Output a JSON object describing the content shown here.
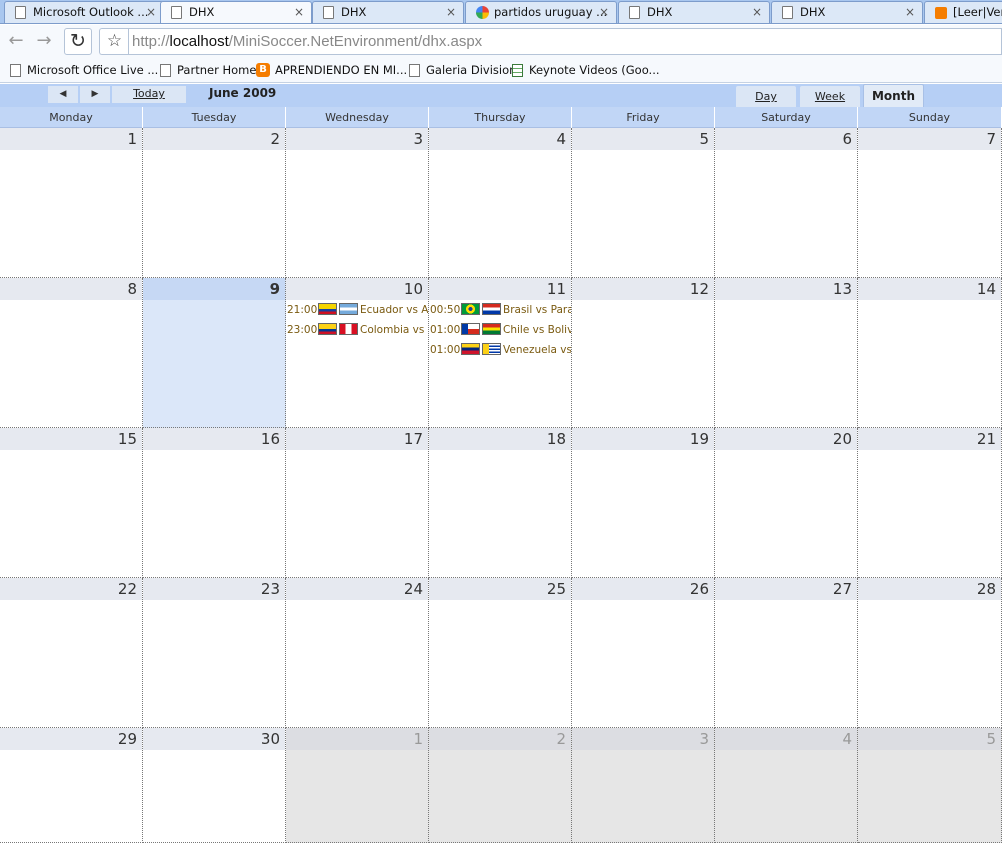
{
  "browser": {
    "tabs": [
      {
        "title": "Microsoft Outlook ...",
        "icon": "page-icon"
      },
      {
        "title": "DHX",
        "icon": "page-icon"
      },
      {
        "title": "DHX",
        "icon": "page-icon"
      },
      {
        "title": "partidos uruguay ...",
        "icon": "google-icon"
      },
      {
        "title": "DHX",
        "icon": "page-icon"
      },
      {
        "title": "DHX",
        "icon": "page-icon"
      },
      {
        "title": "[Leer|Ver",
        "icon": "blogger-icon"
      }
    ],
    "url_prefix": "http://",
    "url_host": "localhost",
    "url_path": "/MiniSoccer.NetEnvironment/dhx.aspx",
    "bookmarks": [
      {
        "label": "Microsoft Office Live ...",
        "icon": "page-icon"
      },
      {
        "label": "Partner Home",
        "icon": "page-icon"
      },
      {
        "label": "APRENDIENDO EN MI...",
        "icon": "blogger-icon"
      },
      {
        "label": "Galeria Division",
        "icon": "page-icon"
      },
      {
        "label": "Keynote Videos (Goo...",
        "icon": "spreadsheet-icon"
      }
    ]
  },
  "scheduler": {
    "today_label": "Today",
    "month_title": "June 2009",
    "views": {
      "day": "Day",
      "week": "Week",
      "month": "Month",
      "active": "month"
    },
    "weekdays": [
      "Monday",
      "Tuesday",
      "Wednesday",
      "Thursday",
      "Friday",
      "Saturday",
      "Sunday"
    ],
    "weeks": [
      [
        {
          "d": "1"
        },
        {
          "d": "2"
        },
        {
          "d": "3"
        },
        {
          "d": "4"
        },
        {
          "d": "5"
        },
        {
          "d": "6"
        },
        {
          "d": "7"
        }
      ],
      [
        {
          "d": "8"
        },
        {
          "d": "9",
          "today": true
        },
        {
          "d": "10",
          "events": [
            {
              "time": "21:00",
              "flags": [
                "ecuador",
                "argentina"
              ],
              "text": "Ecuador vs Argentina"
            },
            {
              "time": "23:00",
              "flags": [
                "colombia",
                "peru"
              ],
              "text": "Colombia vs Peru"
            }
          ]
        },
        {
          "d": "11",
          "events": [
            {
              "time": "00:50",
              "flags": [
                "brazil",
                "paraguay"
              ],
              "text": "Brasil vs Paraguay"
            },
            {
              "time": "01:00",
              "flags": [
                "chile",
                "bolivia"
              ],
              "text": "Chile vs Bolivia"
            },
            {
              "time": "01:00",
              "flags": [
                "venezuela",
                "uruguay"
              ],
              "text": "Venezuela vs Uruguay"
            }
          ]
        },
        {
          "d": "12"
        },
        {
          "d": "13"
        },
        {
          "d": "14"
        }
      ],
      [
        {
          "d": "15"
        },
        {
          "d": "16"
        },
        {
          "d": "17"
        },
        {
          "d": "18"
        },
        {
          "d": "19"
        },
        {
          "d": "20"
        },
        {
          "d": "21"
        }
      ],
      [
        {
          "d": "22"
        },
        {
          "d": "23"
        },
        {
          "d": "24"
        },
        {
          "d": "25"
        },
        {
          "d": "26"
        },
        {
          "d": "27"
        },
        {
          "d": "28"
        }
      ],
      [
        {
          "d": "29"
        },
        {
          "d": "30"
        },
        {
          "d": "1",
          "other": true
        },
        {
          "d": "2",
          "other": true
        },
        {
          "d": "3",
          "other": true
        },
        {
          "d": "4",
          "other": true
        },
        {
          "d": "5",
          "other": true
        }
      ]
    ]
  }
}
